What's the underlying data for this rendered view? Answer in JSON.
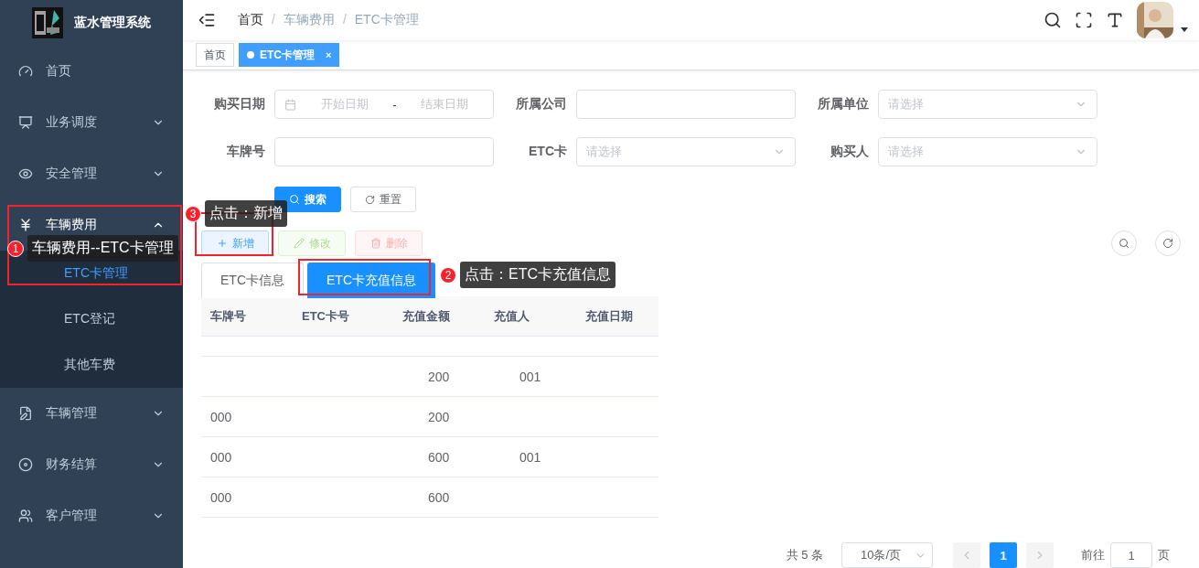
{
  "app": {
    "title": "蓝水管理系统"
  },
  "sidebar": {
    "items": [
      {
        "label": "首页"
      },
      {
        "label": "业务调度",
        "expanded": false
      },
      {
        "label": "安全管理",
        "expanded": false
      },
      {
        "label": "车辆费用",
        "expanded": true,
        "children": [
          {
            "label": "ETC卡管理",
            "selected": true
          },
          {
            "label": "ETC登记",
            "selected": false
          },
          {
            "label": "其他车费",
            "selected": false
          }
        ]
      },
      {
        "label": "车辆管理",
        "expanded": false
      },
      {
        "label": "财务结算",
        "expanded": false
      },
      {
        "label": "客户管理",
        "expanded": false
      }
    ]
  },
  "breadcrumb": [
    "首页",
    "车辆费用",
    "ETC卡管理"
  ],
  "breadcrumb_separator": "/",
  "tags": [
    {
      "label": "首页",
      "selected": false
    },
    {
      "label": "ETC卡管理",
      "selected": true,
      "close": "×"
    }
  ],
  "form": {
    "fields": [
      {
        "label": "购买日期",
        "kind": "daterange",
        "start_placeholder": "开始日期",
        "separator": "-",
        "end_placeholder": "结束日期"
      },
      {
        "label": "所属公司",
        "kind": "text"
      },
      {
        "label": "所属单位",
        "kind": "select",
        "placeholder": "请选择"
      },
      {
        "label": "车牌号",
        "kind": "text"
      },
      {
        "label": "ETC卡",
        "kind": "select",
        "placeholder": "请选择"
      },
      {
        "label": "购买人",
        "kind": "select",
        "placeholder": "请选择"
      }
    ],
    "buttons": [
      {
        "label": "搜索",
        "kind": "primary"
      },
      {
        "label": "重置",
        "kind": "default"
      }
    ]
  },
  "actions": [
    {
      "label": "新增",
      "kind": "add",
      "disabled": false
    },
    {
      "label": "修改",
      "kind": "edit",
      "disabled": true
    },
    {
      "label": "删除",
      "kind": "delete",
      "disabled": true
    }
  ],
  "tabs": [
    {
      "label": "ETC卡信息",
      "selected": false
    },
    {
      "label": "ETC卡充值信息",
      "selected": true
    }
  ],
  "table": {
    "columns": [
      "车牌号",
      "ETC卡号",
      "充值金额",
      "充值人",
      "充值日期"
    ],
    "rows": [
      {
        "cells": [
          null,
          null,
          "200",
          "001",
          null
        ]
      },
      {
        "cells": [
          "000",
          null,
          "200",
          null,
          null
        ]
      },
      {
        "cells": [
          "000",
          null,
          "600",
          "001",
          null
        ]
      },
      {
        "cells": [
          "000",
          null,
          "600",
          null,
          null
        ]
      }
    ]
  },
  "pagination": {
    "total": "共 5 条",
    "page_size": "10条/页",
    "pages": [
      {
        "label": "1",
        "selected": true
      }
    ],
    "goto_label": "前往",
    "goto_value": "1",
    "goto_suffix": "页"
  },
  "annotations": [
    {
      "number": "1",
      "text": "车辆费用--ETC卡管理"
    },
    {
      "number": "2",
      "text": "点击：ETC卡充值信息"
    },
    {
      "number": "3",
      "text": "点击：新增"
    }
  ]
}
